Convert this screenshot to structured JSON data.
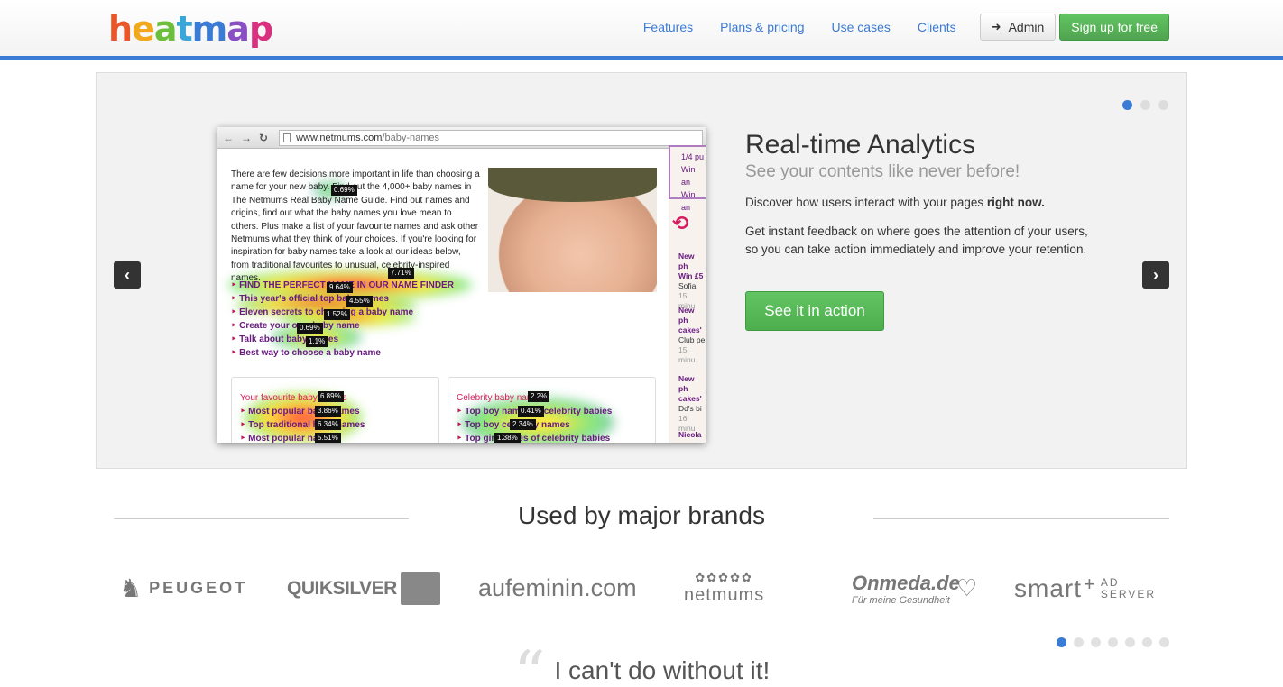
{
  "header": {
    "logo": [
      "h",
      "e",
      "a",
      "t",
      "m",
      "a",
      "p"
    ],
    "logo_colors": [
      "#e8562a",
      "#f2a81d",
      "#6cbf3c",
      "#3aa6d8",
      "#3a7bd5",
      "#8a4fc2",
      "#d9307f"
    ],
    "nav": [
      "Features",
      "Plans & pricing",
      "Use cases",
      "Clients"
    ],
    "admin_label": "Admin",
    "signup_label": "Sign up for free"
  },
  "carousel": {
    "title": "Real-time Analytics",
    "subtitle": "See your contents like never before!",
    "p1_text": "Discover how users interact with your pages ",
    "p1_bold": "right now.",
    "p2": "Get instant feedback on where goes the attention of your users, so you can take action immediately and improve your retention.",
    "cta": "See it in action",
    "prev": "‹",
    "next": "›"
  },
  "screenshot": {
    "url_host": "www.netmums.com",
    "url_path": "/baby-names",
    "intro": "There are few decisions more important in life than choosing a name for your new baby. Find out the 4,000+ baby names in The Netmums Real Baby Name Guide. Find out names and origins, find out what the baby names you love mean to others. Plus make a list of your favourite names and ask other Netmums what they think of your choices. If you're looking for inspiration for baby names take a look at our ideas below, from traditional favourites to unusual, celebrity-inspired names.",
    "links": [
      "FIND THE PERFECT NAME IN OUR NAME FINDER",
      "This year's official top baby names",
      "Eleven secrets to choosing a baby name",
      "Create your own baby name",
      "Talk about baby names",
      "Best way to choose a baby name"
    ],
    "box1_title": "Your favourite baby names",
    "box1_items": [
      "Most popular baby names",
      "Top traditional baby names",
      "Most popular names"
    ],
    "box2_title": "Celebrity baby names",
    "box2_items": [
      "Top boy names of celebrity babies",
      "Top boy celebrity names",
      "Top girl names of celebrity babies"
    ],
    "side_promo": [
      "1/4 pu",
      "Win an",
      "Win an"
    ],
    "side_news": [
      {
        "t": "New ph",
        "t2": "Win £5",
        "s": "Sofia",
        "m": "15 minu"
      },
      {
        "t": "New ph",
        "t2": "cakes'",
        "s": "Club pe",
        "m": "15 minu"
      },
      {
        "t": "New ph",
        "t2": "cakes'",
        "s": "Dd's bi",
        "m": "16 minu"
      },
      {
        "t": "Nicola",
        "t2": "",
        "s": "",
        "m": ""
      }
    ],
    "percents": [
      "0.69%",
      "7.71%",
      "9.64%",
      "4.55%",
      "1.52%",
      "0.69%",
      "1.1%",
      "6.89%",
      "3.86%",
      "6.34%",
      "5.51%",
      "2.2%",
      "0.41%",
      "2.34%",
      "1.38%"
    ]
  },
  "brands": {
    "title": "Used by major brands",
    "logos": [
      "PEUGEOT",
      "QUIKSILVER",
      "aufeminin.com",
      "netmums",
      "Onmeda.de",
      "Für meine Gesundheit",
      "smart",
      "AD",
      "SERVER"
    ]
  },
  "quote": {
    "mark": "“",
    "text": "I can't do without it!"
  }
}
